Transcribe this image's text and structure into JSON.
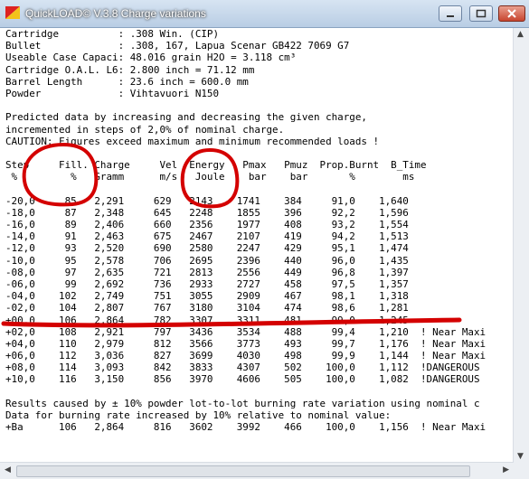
{
  "window": {
    "title": "QuickLOAD© V.3.8 Charge variations",
    "accent_color": "#cc0000"
  },
  "report": {
    "lines": [
      "Cartridge          : .308 Win. (CIP)",
      "Bullet             : .308, 167, Lapua Scenar GB422 7069 G7",
      "Useable Case Capaci: 48.016 grain H2O = 3.118 cm³",
      "Cartridge O.A.L. L6: 2.800 inch = 71.12 mm",
      "Barrel Length      : 23.6 inch = 600.0 mm",
      "Powder             : Vihtavuori N150",
      "",
      "Predicted data by increasing and decreasing the given charge,",
      "incremented in steps of 2,0% of nominal charge.",
      "CAUTION: Figures exceed maximum and minimum recommended loads !",
      "",
      "Step     Fill. Charge     Vel  Energy   Pmax   Pmuz  Prop.Burnt  B_Time",
      " %         %   Gramm      m/s   Joule    bar    bar       %        ms",
      "",
      "-20,0     85   2,291     629   2143    1741    384     91,0    1,640",
      "-18,0     87   2,348     645   2248    1855    396     92,2    1,596",
      "-16,0     89   2,406     660   2356    1977    408     93,2    1,554",
      "-14,0     91   2,463     675   2467    2107    419     94,2    1,513",
      "-12,0     93   2,520     690   2580    2247    429     95,1    1,474",
      "-10,0     95   2,578     706   2695    2396    440     96,0    1,435",
      "-08,0     97   2,635     721   2813    2556    449     96,8    1,397",
      "-06,0     99   2,692     736   2933    2727    458     97,5    1,357",
      "-04,0    102   2,749     751   3055    2909    467     98,1    1,318",
      "-02,0    104   2,807     767   3180    3104    474     98,6    1,281",
      "+00,0    106   2,864     782   3307    3311    481     99,0    1,245",
      "+02,0    108   2,921     797   3436    3534    488     99,4    1,210  ! Near Maxi",
      "+04,0    110   2,979     812   3566    3773    493     99,7    1,176  ! Near Maxi",
      "+06,0    112   3,036     827   3699    4030    498     99,9    1,144  ! Near Maxi",
      "+08,0    114   3,093     842   3833    4307    502    100,0    1,112  !DANGEROUS",
      "+10,0    116   3,150     856   3970    4606    505    100,0    1,082  !DANGEROUS",
      "",
      "Results caused by ± 10% powder lot-to-lot burning rate variation using nominal c",
      "Data for burning rate increased by 10% relative to nominal value:",
      "+Ba      106   2,864     816   3602    3992    466    100,0    1,156  ! Near Maxi"
    ]
  }
}
